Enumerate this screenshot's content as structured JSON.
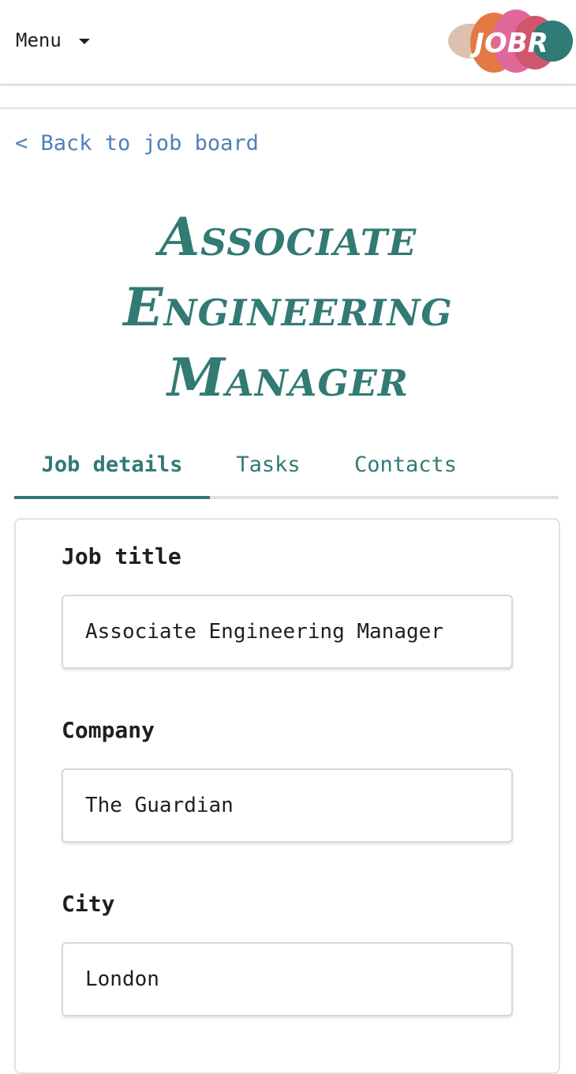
{
  "header": {
    "menu_label": "Menu",
    "logo_text": "JOBR",
    "logo_colors": [
      "#dcc2ae",
      "#e37944",
      "#e0679a",
      "#d0566e",
      "#2f7b75"
    ]
  },
  "back_link": "< Back to job board",
  "page_title": "Associate Engineering Manager",
  "tabs": [
    {
      "label": "Job details",
      "active": true
    },
    {
      "label": "Tasks",
      "active": false
    },
    {
      "label": "Contacts",
      "active": false
    }
  ],
  "form": {
    "job_title": {
      "label": "Job title",
      "value": "Associate Engineering Manager"
    },
    "company": {
      "label": "Company",
      "value": "The Guardian"
    },
    "city": {
      "label": "City",
      "value": "London"
    }
  },
  "colors": {
    "accent": "#327a74",
    "link": "#4f80b8",
    "text": "#1f1f1f"
  }
}
